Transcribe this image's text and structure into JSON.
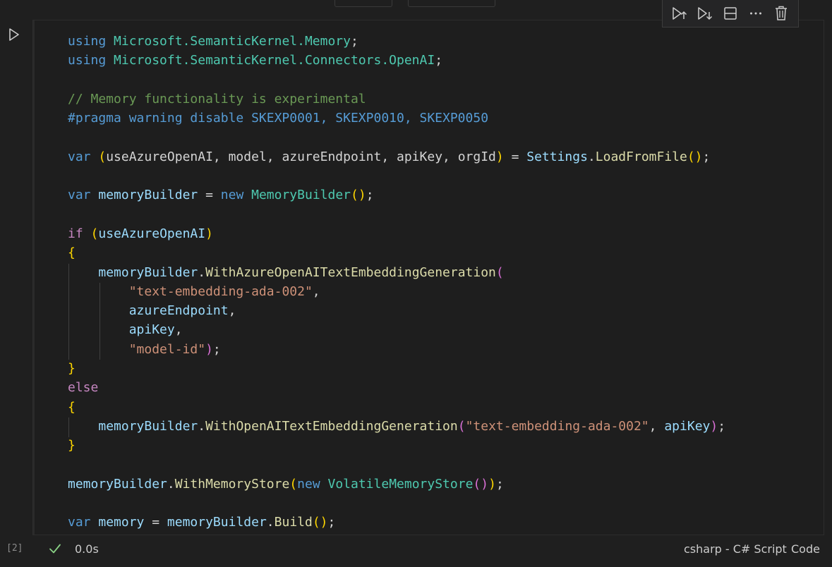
{
  "cell": {
    "execution_count": "[2]",
    "exec_time": "0.0s",
    "language": "csharp - C# Script",
    "cell_kind": "Code"
  },
  "toolbar": {
    "buttons": [
      "execute-above-icon",
      "execute-below-icon",
      "split-cell-icon",
      "more-actions-icon",
      "delete-cell-icon"
    ]
  },
  "code": {
    "l1_kw": "using",
    "l1_ns": "Microsoft.SemanticKernel.Memory",
    "l2_kw": "using",
    "l2_ns": "Microsoft.SemanticKernel.Connectors.OpenAI",
    "l4_comment": "// Memory functionality is experimental",
    "l5_pragma": "#pragma warning disable SKEXP0001, SKEXP0010, SKEXP0050",
    "l7_var": "var",
    "l7_names": "useAzureOpenAI, model, azureEndpoint, apiKey, orgId",
    "l7_settings": "Settings",
    "l7_fn": "LoadFromFile",
    "l9_var": "var",
    "l9_name": "memoryBuilder",
    "l9_new": "new",
    "l9_type": "MemoryBuilder",
    "l11_if": "if",
    "l11_cond": "useAzureOpenAI",
    "l13_obj": "memoryBuilder",
    "l13_fn": "WithAzureOpenAITextEmbeddingGeneration",
    "l14_str": "\"text-embedding-ada-002\"",
    "l15_arg": "azureEndpoint",
    "l16_arg": "apiKey",
    "l17_str": "\"model-id\"",
    "l19_else": "else",
    "l21_obj": "memoryBuilder",
    "l21_fn": "WithOpenAITextEmbeddingGeneration",
    "l21_str": "\"text-embedding-ada-002\"",
    "l21_arg": "apiKey",
    "l24_obj": "memoryBuilder",
    "l24_fn": "WithMemoryStore",
    "l24_new": "new",
    "l24_type": "VolatileMemoryStore",
    "l26_var": "var",
    "l26_name": "memory",
    "l26_obj": "memoryBuilder",
    "l26_fn": "Build"
  }
}
